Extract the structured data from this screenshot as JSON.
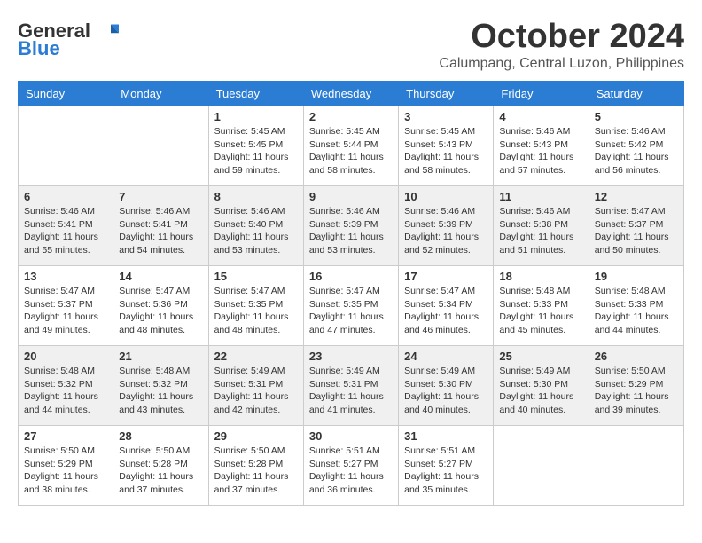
{
  "logo": {
    "general": "General",
    "blue": "Blue"
  },
  "title": "October 2024",
  "location": "Calumpang, Central Luzon, Philippines",
  "days_of_week": [
    "Sunday",
    "Monday",
    "Tuesday",
    "Wednesday",
    "Thursday",
    "Friday",
    "Saturday"
  ],
  "weeks": [
    [
      {
        "day": "",
        "content": ""
      },
      {
        "day": "",
        "content": ""
      },
      {
        "day": "1",
        "sunrise": "Sunrise: 5:45 AM",
        "sunset": "Sunset: 5:45 PM",
        "daylight": "Daylight: 11 hours and 59 minutes."
      },
      {
        "day": "2",
        "sunrise": "Sunrise: 5:45 AM",
        "sunset": "Sunset: 5:44 PM",
        "daylight": "Daylight: 11 hours and 58 minutes."
      },
      {
        "day": "3",
        "sunrise": "Sunrise: 5:45 AM",
        "sunset": "Sunset: 5:43 PM",
        "daylight": "Daylight: 11 hours and 58 minutes."
      },
      {
        "day": "4",
        "sunrise": "Sunrise: 5:46 AM",
        "sunset": "Sunset: 5:43 PM",
        "daylight": "Daylight: 11 hours and 57 minutes."
      },
      {
        "day": "5",
        "sunrise": "Sunrise: 5:46 AM",
        "sunset": "Sunset: 5:42 PM",
        "daylight": "Daylight: 11 hours and 56 minutes."
      }
    ],
    [
      {
        "day": "6",
        "sunrise": "Sunrise: 5:46 AM",
        "sunset": "Sunset: 5:41 PM",
        "daylight": "Daylight: 11 hours and 55 minutes."
      },
      {
        "day": "7",
        "sunrise": "Sunrise: 5:46 AM",
        "sunset": "Sunset: 5:41 PM",
        "daylight": "Daylight: 11 hours and 54 minutes."
      },
      {
        "day": "8",
        "sunrise": "Sunrise: 5:46 AM",
        "sunset": "Sunset: 5:40 PM",
        "daylight": "Daylight: 11 hours and 53 minutes."
      },
      {
        "day": "9",
        "sunrise": "Sunrise: 5:46 AM",
        "sunset": "Sunset: 5:39 PM",
        "daylight": "Daylight: 11 hours and 53 minutes."
      },
      {
        "day": "10",
        "sunrise": "Sunrise: 5:46 AM",
        "sunset": "Sunset: 5:39 PM",
        "daylight": "Daylight: 11 hours and 52 minutes."
      },
      {
        "day": "11",
        "sunrise": "Sunrise: 5:46 AM",
        "sunset": "Sunset: 5:38 PM",
        "daylight": "Daylight: 11 hours and 51 minutes."
      },
      {
        "day": "12",
        "sunrise": "Sunrise: 5:47 AM",
        "sunset": "Sunset: 5:37 PM",
        "daylight": "Daylight: 11 hours and 50 minutes."
      }
    ],
    [
      {
        "day": "13",
        "sunrise": "Sunrise: 5:47 AM",
        "sunset": "Sunset: 5:37 PM",
        "daylight": "Daylight: 11 hours and 49 minutes."
      },
      {
        "day": "14",
        "sunrise": "Sunrise: 5:47 AM",
        "sunset": "Sunset: 5:36 PM",
        "daylight": "Daylight: 11 hours and 48 minutes."
      },
      {
        "day": "15",
        "sunrise": "Sunrise: 5:47 AM",
        "sunset": "Sunset: 5:35 PM",
        "daylight": "Daylight: 11 hours and 48 minutes."
      },
      {
        "day": "16",
        "sunrise": "Sunrise: 5:47 AM",
        "sunset": "Sunset: 5:35 PM",
        "daylight": "Daylight: 11 hours and 47 minutes."
      },
      {
        "day": "17",
        "sunrise": "Sunrise: 5:47 AM",
        "sunset": "Sunset: 5:34 PM",
        "daylight": "Daylight: 11 hours and 46 minutes."
      },
      {
        "day": "18",
        "sunrise": "Sunrise: 5:48 AM",
        "sunset": "Sunset: 5:33 PM",
        "daylight": "Daylight: 11 hours and 45 minutes."
      },
      {
        "day": "19",
        "sunrise": "Sunrise: 5:48 AM",
        "sunset": "Sunset: 5:33 PM",
        "daylight": "Daylight: 11 hours and 44 minutes."
      }
    ],
    [
      {
        "day": "20",
        "sunrise": "Sunrise: 5:48 AM",
        "sunset": "Sunset: 5:32 PM",
        "daylight": "Daylight: 11 hours and 44 minutes."
      },
      {
        "day": "21",
        "sunrise": "Sunrise: 5:48 AM",
        "sunset": "Sunset: 5:32 PM",
        "daylight": "Daylight: 11 hours and 43 minutes."
      },
      {
        "day": "22",
        "sunrise": "Sunrise: 5:49 AM",
        "sunset": "Sunset: 5:31 PM",
        "daylight": "Daylight: 11 hours and 42 minutes."
      },
      {
        "day": "23",
        "sunrise": "Sunrise: 5:49 AM",
        "sunset": "Sunset: 5:31 PM",
        "daylight": "Daylight: 11 hours and 41 minutes."
      },
      {
        "day": "24",
        "sunrise": "Sunrise: 5:49 AM",
        "sunset": "Sunset: 5:30 PM",
        "daylight": "Daylight: 11 hours and 40 minutes."
      },
      {
        "day": "25",
        "sunrise": "Sunrise: 5:49 AM",
        "sunset": "Sunset: 5:30 PM",
        "daylight": "Daylight: 11 hours and 40 minutes."
      },
      {
        "day": "26",
        "sunrise": "Sunrise: 5:50 AM",
        "sunset": "Sunset: 5:29 PM",
        "daylight": "Daylight: 11 hours and 39 minutes."
      }
    ],
    [
      {
        "day": "27",
        "sunrise": "Sunrise: 5:50 AM",
        "sunset": "Sunset: 5:29 PM",
        "daylight": "Daylight: 11 hours and 38 minutes."
      },
      {
        "day": "28",
        "sunrise": "Sunrise: 5:50 AM",
        "sunset": "Sunset: 5:28 PM",
        "daylight": "Daylight: 11 hours and 37 minutes."
      },
      {
        "day": "29",
        "sunrise": "Sunrise: 5:50 AM",
        "sunset": "Sunset: 5:28 PM",
        "daylight": "Daylight: 11 hours and 37 minutes."
      },
      {
        "day": "30",
        "sunrise": "Sunrise: 5:51 AM",
        "sunset": "Sunset: 5:27 PM",
        "daylight": "Daylight: 11 hours and 36 minutes."
      },
      {
        "day": "31",
        "sunrise": "Sunrise: 5:51 AM",
        "sunset": "Sunset: 5:27 PM",
        "daylight": "Daylight: 11 hours and 35 minutes."
      },
      {
        "day": "",
        "content": ""
      },
      {
        "day": "",
        "content": ""
      }
    ]
  ]
}
